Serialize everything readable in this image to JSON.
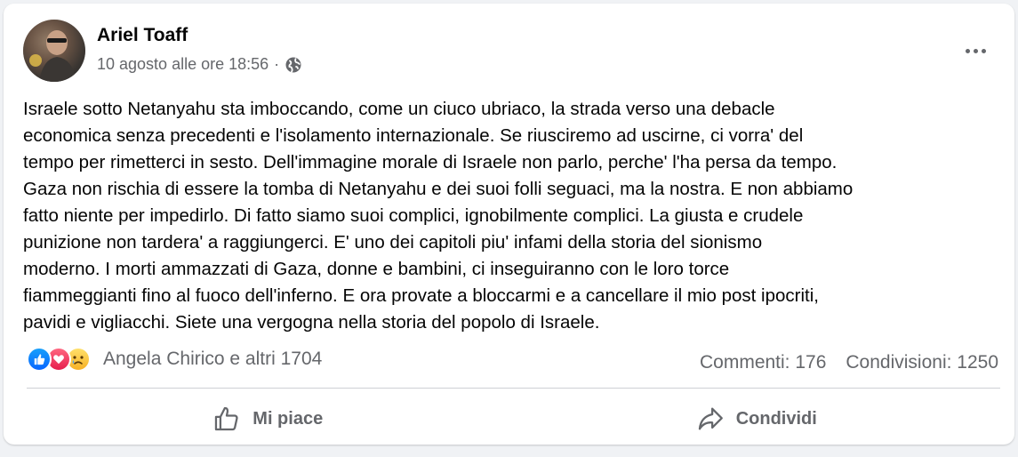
{
  "post": {
    "author": "Ariel Toaff",
    "timestamp": "10 agosto alle ore 18:56",
    "separator": "·",
    "privacy_icon": "globe-icon",
    "text": "Israele sotto Netanyahu sta imboccando, come un ciuco ubriaco, la strada verso una debacle\neconomica senza precedenti e l'isolamento internazionale. Se riusciremo ad uscirne, ci vorra' del\ntempo per rimetterci in sesto. Dell'immagine morale di Israele non parlo, perche' l'ha persa da tempo.\nGaza non rischia di essere la tomba di Netanyahu e dei suoi folli seguaci, ma la nostra. E non abbiamo\nfatto niente per impedirlo. Di fatto siamo suoi complici, ignobilmente complici. La giusta e crudele\npunizione non tardera' a raggiungerci. E' uno dei capitoli piu' infami della storia del sionismo\nmoderno. I morti ammazzati di Gaza, donne e bambini, ci inseguiranno con le loro torce\nfiammeggianti fino al fuoco dell'inferno. E ora provate a bloccarmi e a cancellare il mio post ipocriti,\npavidi e vigliacchi. Siete una vergogna nella storia del popolo di Israele."
  },
  "reactions": {
    "icons": [
      "like-icon",
      "love-icon",
      "sad-icon"
    ],
    "summary": "Angela Chirico e altri 1704"
  },
  "stats": {
    "comments": "Commenti: 176",
    "shares": "Condivisioni: 1250"
  },
  "actions": {
    "like_label": "Mi piace",
    "share_label": "Condividi"
  },
  "colors": {
    "secondary_text": "#65676b",
    "like_blue": "#0866ff",
    "love_red": "#e61e4d",
    "sad_yellow": "#f7b125"
  }
}
